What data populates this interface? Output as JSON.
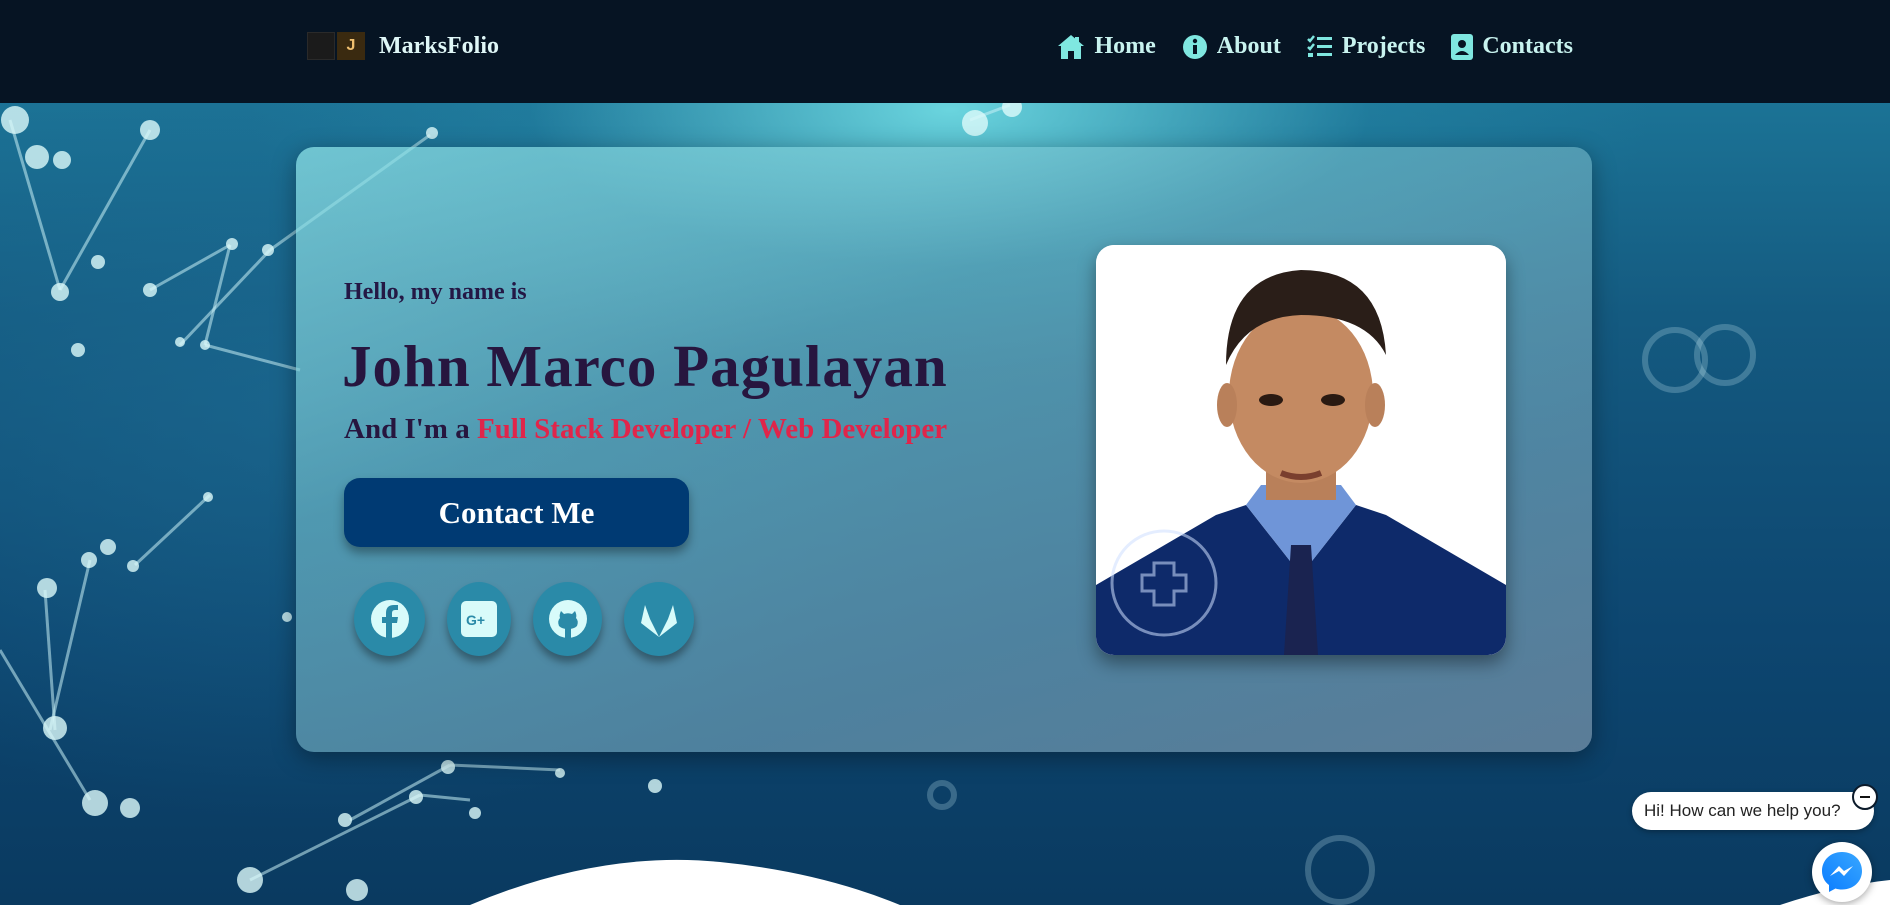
{
  "navbar": {
    "brand": "MarksFolio",
    "brand_logo_letter": "J",
    "links": [
      {
        "label": "Home",
        "icon": "home-icon"
      },
      {
        "label": "About",
        "icon": "info-icon"
      },
      {
        "label": "Projects",
        "icon": "checklist-icon"
      },
      {
        "label": "Contacts",
        "icon": "contact-book-icon"
      }
    ]
  },
  "hero": {
    "greeting": "Hello, my name is",
    "name": "John Marco Pagulayan",
    "role_prefix": "And I'm a ",
    "role_highlight": "Full Stack Developer / Web Developer",
    "contact_button": "Contact Me",
    "socials": [
      {
        "icon": "facebook-icon"
      },
      {
        "icon": "google-plus-icon"
      },
      {
        "icon": "github-icon"
      },
      {
        "icon": "gitlab-icon"
      }
    ],
    "photo_alt": "profile-photo",
    "highlight_color": "#e0254a",
    "button_color": "#003a73"
  },
  "chat": {
    "message": "Hi! How can we help you?",
    "icon": "messenger-icon"
  }
}
